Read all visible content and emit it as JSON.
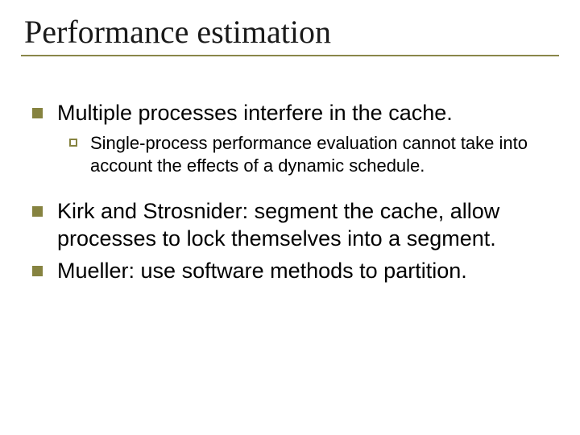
{
  "title": "Performance estimation",
  "bullets": [
    {
      "text": "Multiple processes interfere in the cache.",
      "sub": [
        "Single-process performance evaluation cannot take into account the effects of a dynamic schedule."
      ]
    },
    {
      "text": "Kirk and Strosnider: segment the cache, allow processes to lock themselves into a segment."
    },
    {
      "text": "Mueller: use software methods to partition."
    }
  ]
}
